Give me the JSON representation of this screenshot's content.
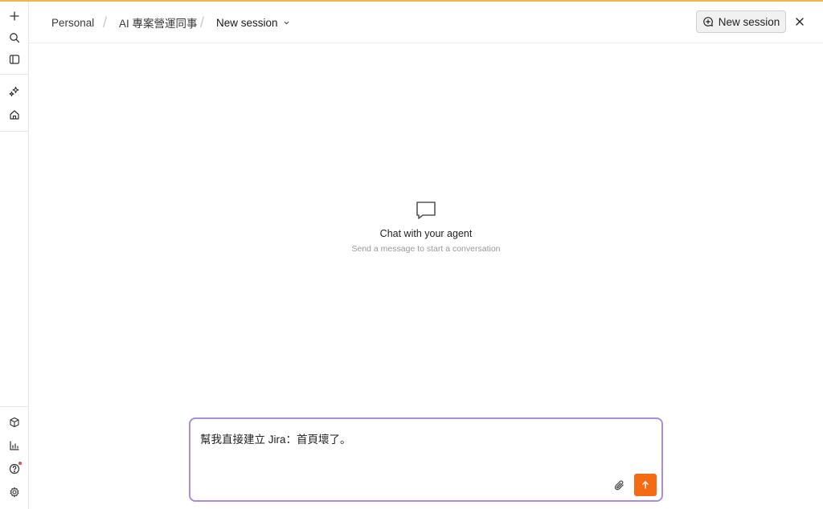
{
  "rail": {
    "top_icons": [
      "plus-icon",
      "search-icon",
      "sidebar-toggle-icon",
      "sparkles-icon",
      "home-icon"
    ],
    "bottom_icons": [
      "package-icon",
      "chart-icon",
      "help-icon",
      "settings-icon"
    ],
    "help_has_notification": true
  },
  "header": {
    "breadcrumb": [
      "Personal",
      "AI 專案營運同事",
      "New session"
    ],
    "separator": "/",
    "new_session_label": "New session"
  },
  "empty_state": {
    "title": "Chat with your agent",
    "subtitle": "Send a message to start a conversation"
  },
  "composer": {
    "text": "幫我直接建立 Jira：首頁壞了。"
  },
  "colors": {
    "accent_top_line": "#f5b544",
    "composer_border": "#a98be0",
    "send_button": "#f56b14",
    "notification_dot": "#e5484d"
  }
}
